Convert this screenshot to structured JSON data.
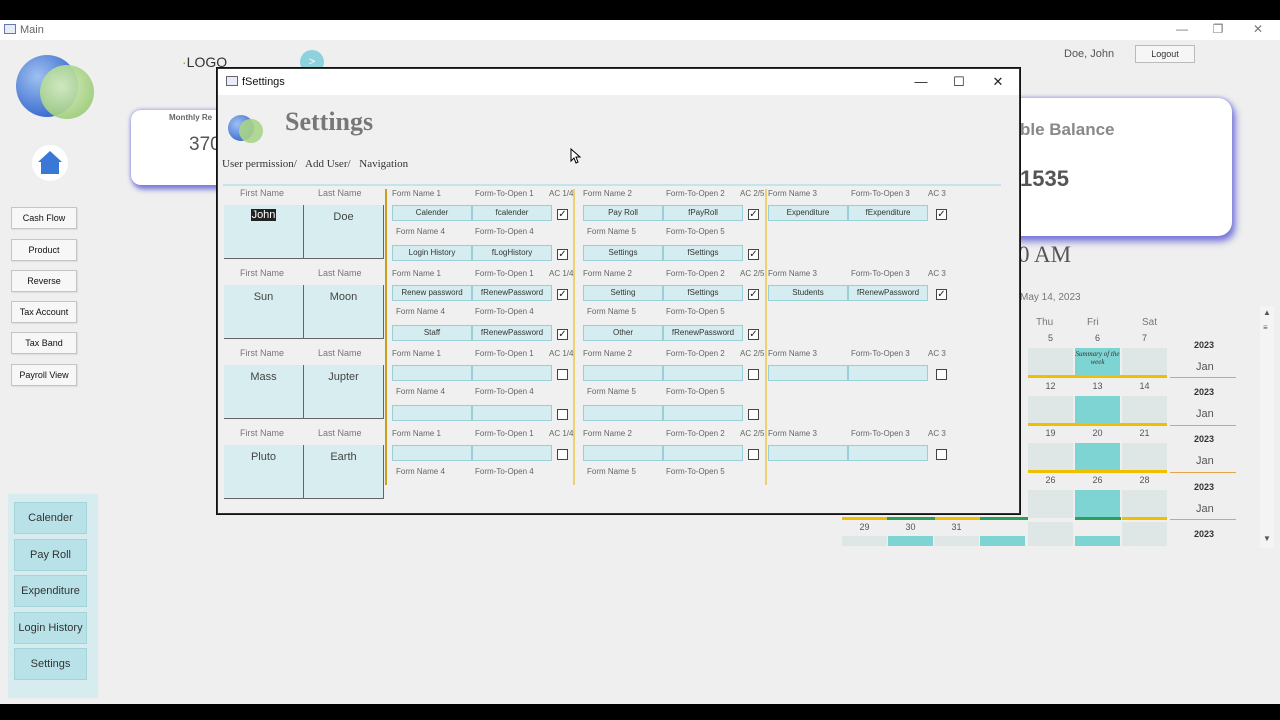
{
  "main_window": {
    "title": "Main"
  },
  "header": {
    "logo": "LOGO",
    "nav_arrow": ">",
    "user_name": "Doe, John",
    "logout": "Logout"
  },
  "sidebar": {
    "buttons": [
      "Cash Flow",
      "Product",
      "Reverse",
      "Tax Account",
      "Tax Band",
      "Payroll View"
    ]
  },
  "bottom_panel": {
    "buttons": [
      "Calender",
      "Pay Roll",
      "Expenditure",
      "Login History",
      "Settings"
    ]
  },
  "cards": {
    "monthly": {
      "label": "Monthly Re",
      "value": "370"
    },
    "balance": {
      "label": "ble Balance",
      "value": "1535"
    }
  },
  "clock": {
    "time": "0 AM",
    "date": "May 14, 2023"
  },
  "calendar": {
    "days": [
      "Thu",
      "Fri",
      "Sat"
    ],
    "rows": [
      {
        "nums": [
          "5",
          "6",
          "7"
        ],
        "year": "2023",
        "month": "Jan",
        "note": "Summary of the week"
      },
      {
        "nums": [
          "12",
          "13",
          "14"
        ],
        "year": "2023",
        "month": "Jan"
      },
      {
        "nums": [
          "19",
          "20",
          "21"
        ],
        "year": "2023",
        "month": "Jan"
      },
      {
        "nums": [
          "26",
          "26",
          "28"
        ],
        "year": "2023",
        "month": "Jan"
      },
      {
        "nums": [
          "29",
          "30",
          "31"
        ],
        "year": "2023"
      }
    ]
  },
  "dialog": {
    "title": "fSettings",
    "heading": "Settings",
    "breadcrumb": [
      "User permission/",
      "Add User/",
      "Navigation"
    ],
    "labels": {
      "first": "First Name",
      "last": "Last Name",
      "fn1": "Form Name 1",
      "fo1": "Form-To-Open 1",
      "ac1": "AC 1/4",
      "fn2": "Form Name 2",
      "fo2": "Form-To-Open 2",
      "ac2": "AC 2/5",
      "fn3": "Form Name 3",
      "fo3": "Form-To-Open 3",
      "ac3": "AC 3",
      "fn4": "Form Name 4",
      "fo4": "Form-To-Open 4",
      "fn5": "Form Name 5",
      "fo5": "Form-To-Open 5"
    },
    "users": [
      {
        "first": "John",
        "last": "Doe",
        "f1": [
          "Calender",
          "fcalender"
        ],
        "f2": [
          "Pay Roll",
          "fPayRoll"
        ],
        "f3": [
          "Expenditure",
          "fExpenditure"
        ],
        "f4": [
          "Login History",
          "fLogHistory"
        ],
        "f5": [
          "Settings",
          "fSettings"
        ]
      },
      {
        "first": "Sun",
        "last": "Moon",
        "f1": [
          "Renew password",
          "fRenewPassword"
        ],
        "f2": [
          "Setting",
          "fSettings"
        ],
        "f3": [
          "Students",
          "fRenewPassword"
        ],
        "f4": [
          "Staff",
          "fRenewPassword"
        ],
        "f5": [
          "Other",
          "fRenewPassword"
        ]
      },
      {
        "first": "Mass",
        "last": "Jupter"
      },
      {
        "first": "Pluto",
        "last": "Earth"
      }
    ]
  }
}
